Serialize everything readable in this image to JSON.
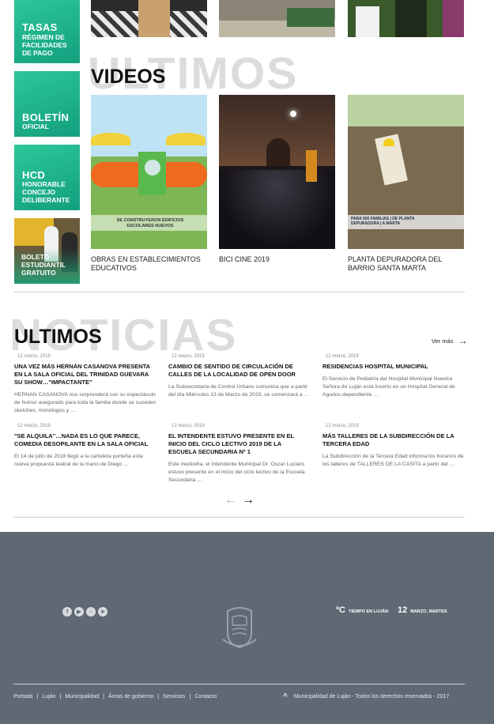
{
  "sidebar": {
    "tasas": {
      "title": "TASAS",
      "sub": "RÉGIMEN DE FACILIDADES DE PAGO"
    },
    "boletin": {
      "title": "BOLETÍN",
      "sub": "OFICIAL"
    },
    "hcd": {
      "title": "HCD",
      "sub": "HONORABLE CONCEJO DELIBERANTE"
    },
    "boleto": {
      "label": "BOLETO ESTUDIANTIL GRATUITO"
    }
  },
  "videos": {
    "ghost": "ULTIMOS",
    "title": "VIDEOS",
    "items": [
      {
        "caption": "OBRAS EN ESTABLECIMIENTOS EDUCATIVOS",
        "overlay": "SE CONSTRUYERON EDIFICIOS ESCOLARES NUEVOS"
      },
      {
        "caption": "BICI CINE 2019",
        "overlay": ""
      },
      {
        "caption": "PLANTA DEPURADORA DEL BARRIO SANTA MARTA",
        "overlay": "PARA 500 FAMILIAS | DE PLANTA DEPURADORA | A MARTA"
      }
    ]
  },
  "news": {
    "ghost": "NOTICIAS",
    "title": "ULTIMOS",
    "ver_mas": "Ver más",
    "items": [
      {
        "date": "12 marzo, 2019",
        "title": "UNA VEZ MÁS HERNÁN CASANOVA PRESENTA EN LA SALA OFICIAL DEL TRINIDAD GUEVARA SU SHOW…\"IMPACTANTE\"",
        "excerpt": "HERNAN CASANOVA nos sorprenderá con su espectáculo de humor asegurado para toda la familia donde se suceden sketches, monólogos y …"
      },
      {
        "date": "12 marzo, 2019",
        "title": "CAMBIO DE SENTIDO DE CIRCULACIÓN DE CALLES DE LA LOCALIDAD DE OPEN DOOR",
        "excerpt": "La Subsecretaria de Control Urbano comunica  que a partir del día Miércoles 13 de Marzo de 2019, se comenzará a …"
      },
      {
        "date": "12 marzo, 2019",
        "title": "RESIDENCIAS HOSPITAL MUNICIPAL",
        "excerpt": "El Servicio de Pediatría del Hospital Municipal Nuestra Señora de Luján está inserto en un Hospital General de Agudos dependiente …"
      },
      {
        "date": "12 marzo, 2019",
        "title": "\"SE ALQUILA\"…NADA ES LO QUE PARECE, COMEDIA DESOPILANTE  EN LA SALA OFICIAL",
        "excerpt": "El 14 de julio de 2018 llegó a la cartelera porteña esta nueva propuesta teatral de la mano de Diego …"
      },
      {
        "date": "12 marzo, 2019",
        "title": "EL INTENDENTE ESTUVO PRESENTE EN EL INICIO DEL CICLO LECTIVO 2019 DE LA ESCUELA SECUNDARIA Nº 1",
        "excerpt": "Este mediodía, el Intendente Municipal Dr. Oscar Luciani, estuvo presente en el inicio del ciclo lectivo de la Escuela Secundaria …"
      },
      {
        "date": "12 marzo, 2019",
        "title": "MÁS TALLERES DE LA SUBDIRECCIÓN DE LA TERCERA EDAD",
        "excerpt": "La Subdirección de la Tercera Edad informa los horarios de los talleres de TALLERES DE LA CASITA a partir del …"
      }
    ],
    "prev_arrow": "←",
    "next_arrow": "→"
  },
  "footer": {
    "social_icons": [
      "facebook-icon",
      "youtube-icon",
      "instagram-icon",
      "telegram-icon"
    ],
    "weather_unit": "ºC",
    "weather_label": "TIEMPO EN LUJÁN",
    "day": "12",
    "date_label": "MARZO, MARTES",
    "links": [
      "Portada",
      "Luján",
      "Municipalidad",
      "Áreas de gobierno",
      "Servicios",
      "Contacto"
    ],
    "copyright": "Municipalidad de Luján - Todos los derechos reservados - 2017"
  },
  "colors": {
    "accent": "#1db58c",
    "footer": "#5f6873"
  }
}
